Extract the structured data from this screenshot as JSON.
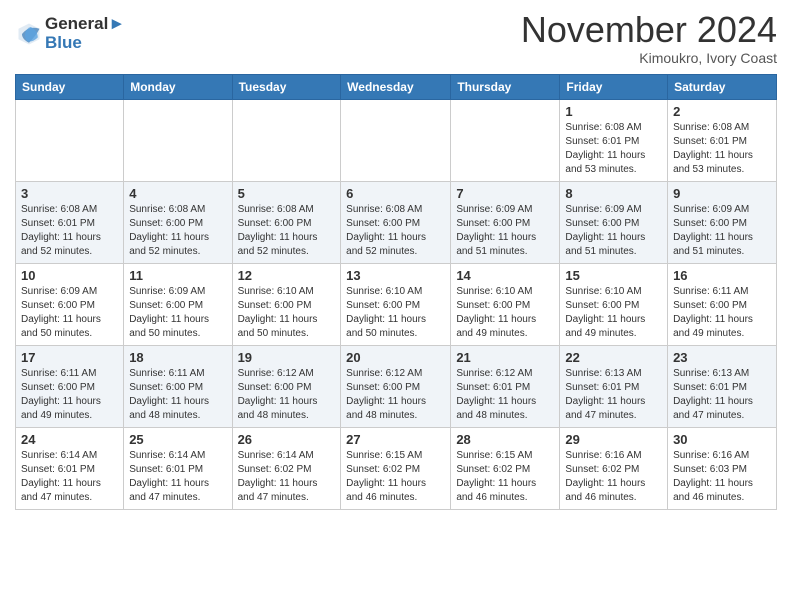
{
  "logo": {
    "line1": "General",
    "line2": "Blue"
  },
  "title": "November 2024",
  "subtitle": "Kimoukro, Ivory Coast",
  "days_header": [
    "Sunday",
    "Monday",
    "Tuesday",
    "Wednesday",
    "Thursday",
    "Friday",
    "Saturday"
  ],
  "weeks": [
    [
      {
        "day": "",
        "info": ""
      },
      {
        "day": "",
        "info": ""
      },
      {
        "day": "",
        "info": ""
      },
      {
        "day": "",
        "info": ""
      },
      {
        "day": "",
        "info": ""
      },
      {
        "day": "1",
        "info": "Sunrise: 6:08 AM\nSunset: 6:01 PM\nDaylight: 11 hours\nand 53 minutes."
      },
      {
        "day": "2",
        "info": "Sunrise: 6:08 AM\nSunset: 6:01 PM\nDaylight: 11 hours\nand 53 minutes."
      }
    ],
    [
      {
        "day": "3",
        "info": "Sunrise: 6:08 AM\nSunset: 6:01 PM\nDaylight: 11 hours\nand 52 minutes."
      },
      {
        "day": "4",
        "info": "Sunrise: 6:08 AM\nSunset: 6:00 PM\nDaylight: 11 hours\nand 52 minutes."
      },
      {
        "day": "5",
        "info": "Sunrise: 6:08 AM\nSunset: 6:00 PM\nDaylight: 11 hours\nand 52 minutes."
      },
      {
        "day": "6",
        "info": "Sunrise: 6:08 AM\nSunset: 6:00 PM\nDaylight: 11 hours\nand 52 minutes."
      },
      {
        "day": "7",
        "info": "Sunrise: 6:09 AM\nSunset: 6:00 PM\nDaylight: 11 hours\nand 51 minutes."
      },
      {
        "day": "8",
        "info": "Sunrise: 6:09 AM\nSunset: 6:00 PM\nDaylight: 11 hours\nand 51 minutes."
      },
      {
        "day": "9",
        "info": "Sunrise: 6:09 AM\nSunset: 6:00 PM\nDaylight: 11 hours\nand 51 minutes."
      }
    ],
    [
      {
        "day": "10",
        "info": "Sunrise: 6:09 AM\nSunset: 6:00 PM\nDaylight: 11 hours\nand 50 minutes."
      },
      {
        "day": "11",
        "info": "Sunrise: 6:09 AM\nSunset: 6:00 PM\nDaylight: 11 hours\nand 50 minutes."
      },
      {
        "day": "12",
        "info": "Sunrise: 6:10 AM\nSunset: 6:00 PM\nDaylight: 11 hours\nand 50 minutes."
      },
      {
        "day": "13",
        "info": "Sunrise: 6:10 AM\nSunset: 6:00 PM\nDaylight: 11 hours\nand 50 minutes."
      },
      {
        "day": "14",
        "info": "Sunrise: 6:10 AM\nSunset: 6:00 PM\nDaylight: 11 hours\nand 49 minutes."
      },
      {
        "day": "15",
        "info": "Sunrise: 6:10 AM\nSunset: 6:00 PM\nDaylight: 11 hours\nand 49 minutes."
      },
      {
        "day": "16",
        "info": "Sunrise: 6:11 AM\nSunset: 6:00 PM\nDaylight: 11 hours\nand 49 minutes."
      }
    ],
    [
      {
        "day": "17",
        "info": "Sunrise: 6:11 AM\nSunset: 6:00 PM\nDaylight: 11 hours\nand 49 minutes."
      },
      {
        "day": "18",
        "info": "Sunrise: 6:11 AM\nSunset: 6:00 PM\nDaylight: 11 hours\nand 48 minutes."
      },
      {
        "day": "19",
        "info": "Sunrise: 6:12 AM\nSunset: 6:00 PM\nDaylight: 11 hours\nand 48 minutes."
      },
      {
        "day": "20",
        "info": "Sunrise: 6:12 AM\nSunset: 6:00 PM\nDaylight: 11 hours\nand 48 minutes."
      },
      {
        "day": "21",
        "info": "Sunrise: 6:12 AM\nSunset: 6:01 PM\nDaylight: 11 hours\nand 48 minutes."
      },
      {
        "day": "22",
        "info": "Sunrise: 6:13 AM\nSunset: 6:01 PM\nDaylight: 11 hours\nand 47 minutes."
      },
      {
        "day": "23",
        "info": "Sunrise: 6:13 AM\nSunset: 6:01 PM\nDaylight: 11 hours\nand 47 minutes."
      }
    ],
    [
      {
        "day": "24",
        "info": "Sunrise: 6:14 AM\nSunset: 6:01 PM\nDaylight: 11 hours\nand 47 minutes."
      },
      {
        "day": "25",
        "info": "Sunrise: 6:14 AM\nSunset: 6:01 PM\nDaylight: 11 hours\nand 47 minutes."
      },
      {
        "day": "26",
        "info": "Sunrise: 6:14 AM\nSunset: 6:02 PM\nDaylight: 11 hours\nand 47 minutes."
      },
      {
        "day": "27",
        "info": "Sunrise: 6:15 AM\nSunset: 6:02 PM\nDaylight: 11 hours\nand 46 minutes."
      },
      {
        "day": "28",
        "info": "Sunrise: 6:15 AM\nSunset: 6:02 PM\nDaylight: 11 hours\nand 46 minutes."
      },
      {
        "day": "29",
        "info": "Sunrise: 6:16 AM\nSunset: 6:02 PM\nDaylight: 11 hours\nand 46 minutes."
      },
      {
        "day": "30",
        "info": "Sunrise: 6:16 AM\nSunset: 6:03 PM\nDaylight: 11 hours\nand 46 minutes."
      }
    ]
  ]
}
